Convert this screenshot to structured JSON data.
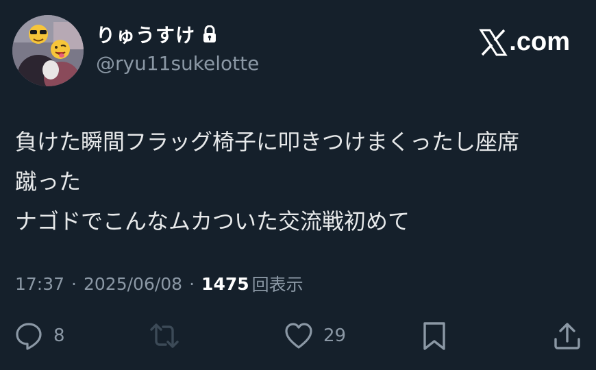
{
  "profile": {
    "display_name": "りゅうすけ",
    "handle": "@ryu11sukelotte",
    "protected": true
  },
  "brand": {
    "text": ".com",
    "logo_icon": "x-logo-icon"
  },
  "tweet": {
    "lines": [
      "負けた瞬間フラッグ椅子に叩きつけまくったし座席",
      "蹴った",
      "ナゴドでこんなムカついた交流戦初めて"
    ]
  },
  "meta": {
    "time": "17:37",
    "separator": "·",
    "date": "2025/06/08",
    "views_count": "1475",
    "views_label": "回表示"
  },
  "actions": {
    "reply_count": "8",
    "retweet_count": "",
    "like_count": "29"
  },
  "colors": {
    "background": "#15202b",
    "text": "#e7e9ea",
    "secondary": "#8b98a5",
    "retweet_disabled": "#3c4a57"
  }
}
